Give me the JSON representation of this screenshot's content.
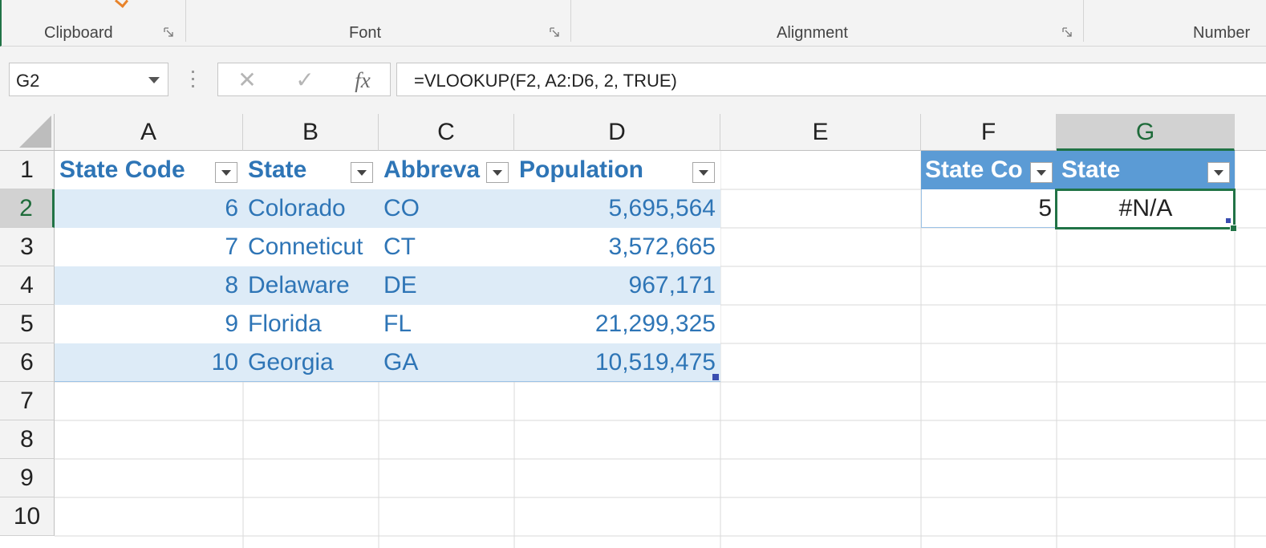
{
  "ribbon": {
    "groups": [
      "Clipboard",
      "Font",
      "Alignment",
      "Number"
    ]
  },
  "name_box": {
    "value": "G2"
  },
  "formula_bar": {
    "cancel_glyph": "✕",
    "enter_glyph": "✓",
    "fx_label": "fx",
    "formula": "=VLOOKUP(F2, A2:D6, 2, TRUE)"
  },
  "columns": [
    "A",
    "B",
    "C",
    "D",
    "E",
    "F",
    "G"
  ],
  "rows": [
    "1",
    "2",
    "3",
    "4",
    "5",
    "6",
    "7",
    "8",
    "9",
    "10"
  ],
  "active_cell": "G2",
  "table1": {
    "headers": [
      "State Code",
      "State",
      "Abbreva",
      "Population"
    ],
    "rows": [
      [
        "6",
        "Colorado",
        "CO",
        "5,695,564"
      ],
      [
        "7",
        "Conneticut",
        "CT",
        "3,572,665"
      ],
      [
        "8",
        "Delaware",
        "DE",
        "967,171"
      ],
      [
        "9",
        "Florida",
        "FL",
        "21,299,325"
      ],
      [
        "10",
        "Georgia",
        "GA",
        "10,519,475"
      ]
    ]
  },
  "table2": {
    "headers": [
      "State Co",
      "State"
    ],
    "rows": [
      [
        "5",
        "#N/A"
      ]
    ]
  },
  "colors": {
    "table_header_text": "#2e75b6",
    "table_band": "#ddebf7",
    "table2_header_fill": "#5b9bd5",
    "selection_green": "#217346"
  }
}
